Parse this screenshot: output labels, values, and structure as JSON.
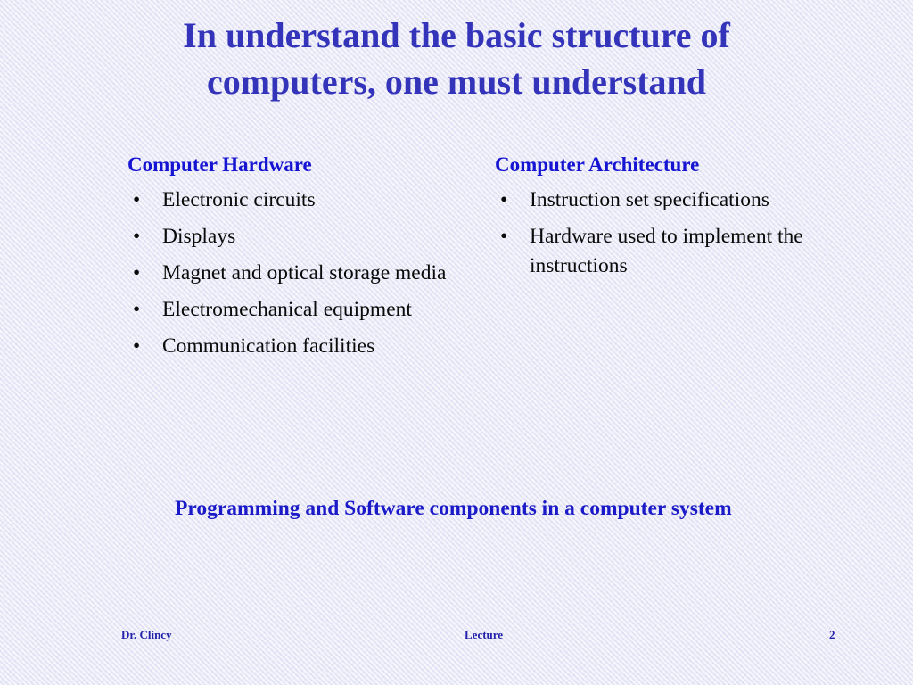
{
  "slide": {
    "title_lines": [
      "In understand the basic structure of",
      "computers, one must understand"
    ],
    "columns": [
      {
        "heading": "Computer Hardware",
        "bullet_glyph": "•",
        "items": [
          "Electronic circuits",
          "Displays",
          "Magnet and optical storage media",
          "Electromechanical equipment",
          "Communication facilities"
        ]
      },
      {
        "heading": "Computer Architecture",
        "bullet_glyph": "•",
        "items": [
          "Instruction set specifications",
          "Hardware used to implement the instructions"
        ]
      }
    ],
    "bottom_note": "Programming and Software components in a computer system",
    "footer": {
      "author": "Dr. Clincy",
      "label": "Lecture",
      "page_number": "2"
    },
    "colors": {
      "background": "#e6e6f6",
      "title_blue": "#3434bb",
      "heading_blue": "#1414d2",
      "note_blue": "#1a1ac8",
      "footer_blue": "#2222aa",
      "body_text": "#0a0a0a"
    }
  }
}
